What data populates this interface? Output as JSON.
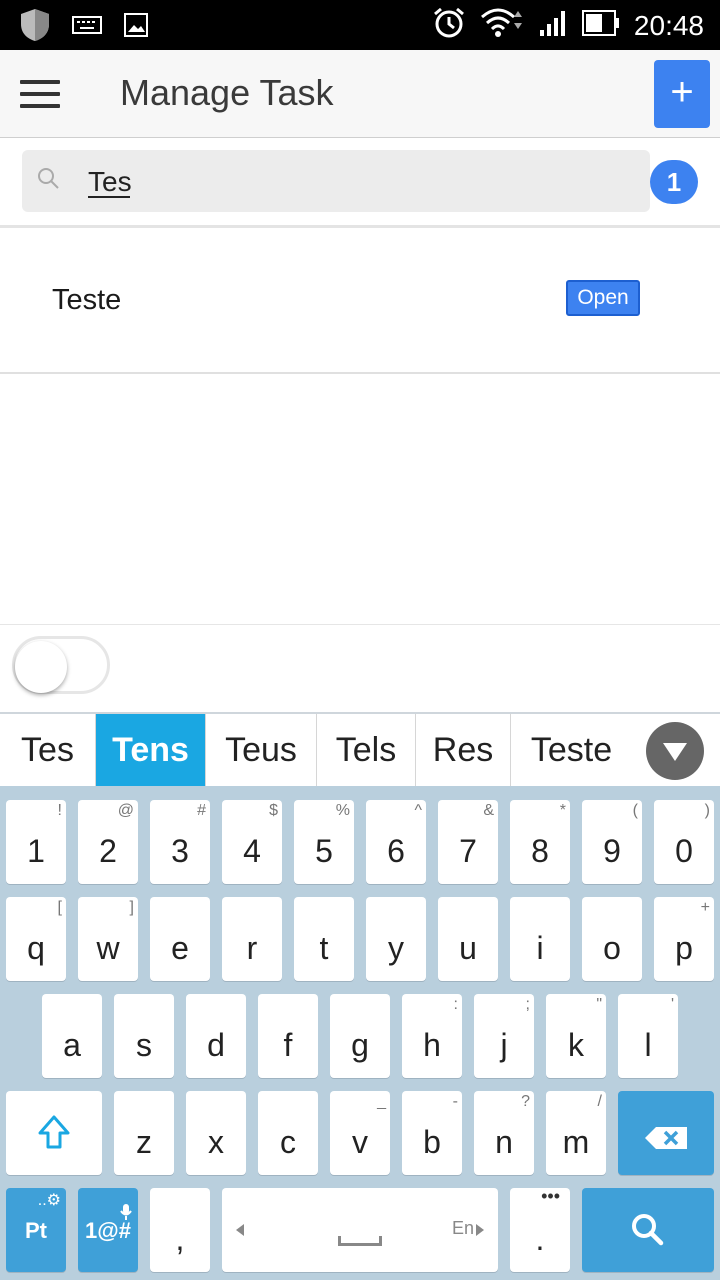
{
  "status_bar": {
    "time": "20:48"
  },
  "app_bar": {
    "title": "Manage Task",
    "add_label": "+"
  },
  "search": {
    "value": "Tes",
    "result_count": "1"
  },
  "tasks": [
    {
      "name": "Teste",
      "status": "Open"
    }
  ],
  "suggestions": [
    "Tes",
    "Tens",
    "Teus",
    "Tels",
    "Res",
    "Teste"
  ],
  "keyboard": {
    "number_row": [
      {
        "key": "1",
        "alt": "!"
      },
      {
        "key": "2",
        "alt": "@"
      },
      {
        "key": "3",
        "alt": "#"
      },
      {
        "key": "4",
        "alt": "$"
      },
      {
        "key": "5",
        "alt": "%"
      },
      {
        "key": "6",
        "alt": "^"
      },
      {
        "key": "7",
        "alt": "&"
      },
      {
        "key": "8",
        "alt": "*"
      },
      {
        "key": "9",
        "alt": "("
      },
      {
        "key": "0",
        "alt": ")"
      }
    ],
    "row1": [
      {
        "key": "q",
        "alt": "["
      },
      {
        "key": "w",
        "alt": "]"
      },
      {
        "key": "e",
        "alt": ""
      },
      {
        "key": "r",
        "alt": ""
      },
      {
        "key": "t",
        "alt": ""
      },
      {
        "key": "y",
        "alt": ""
      },
      {
        "key": "u",
        "alt": ""
      },
      {
        "key": "i",
        "alt": ""
      },
      {
        "key": "o",
        "alt": ""
      },
      {
        "key": "p",
        "alt": "+"
      }
    ],
    "row2": [
      {
        "key": "a",
        "alt": ""
      },
      {
        "key": "s",
        "alt": ""
      },
      {
        "key": "d",
        "alt": ""
      },
      {
        "key": "f",
        "alt": ""
      },
      {
        "key": "g",
        "alt": ""
      },
      {
        "key": "h",
        "alt": ":"
      },
      {
        "key": "j",
        "alt": ";"
      },
      {
        "key": "k",
        "alt": "\""
      },
      {
        "key": "l",
        "alt": "'"
      }
    ],
    "row3": [
      {
        "key": "z",
        "alt": ""
      },
      {
        "key": "x",
        "alt": ""
      },
      {
        "key": "c",
        "alt": ""
      },
      {
        "key": "v",
        "alt": "_"
      },
      {
        "key": "b",
        "alt": "-"
      },
      {
        "key": "n",
        "alt": "?"
      },
      {
        "key": "m",
        "alt": "/"
      }
    ],
    "language_label": "Pt",
    "symbols_label": "1@#",
    "comma_label": ",",
    "space_lang": "En",
    "period_label": "."
  },
  "colors": {
    "accent": "#3d82f0",
    "suggestion_active": "#1aa7e2",
    "keyboard_bg": "#b9cfdd",
    "key_blue": "#3fa0d8"
  }
}
